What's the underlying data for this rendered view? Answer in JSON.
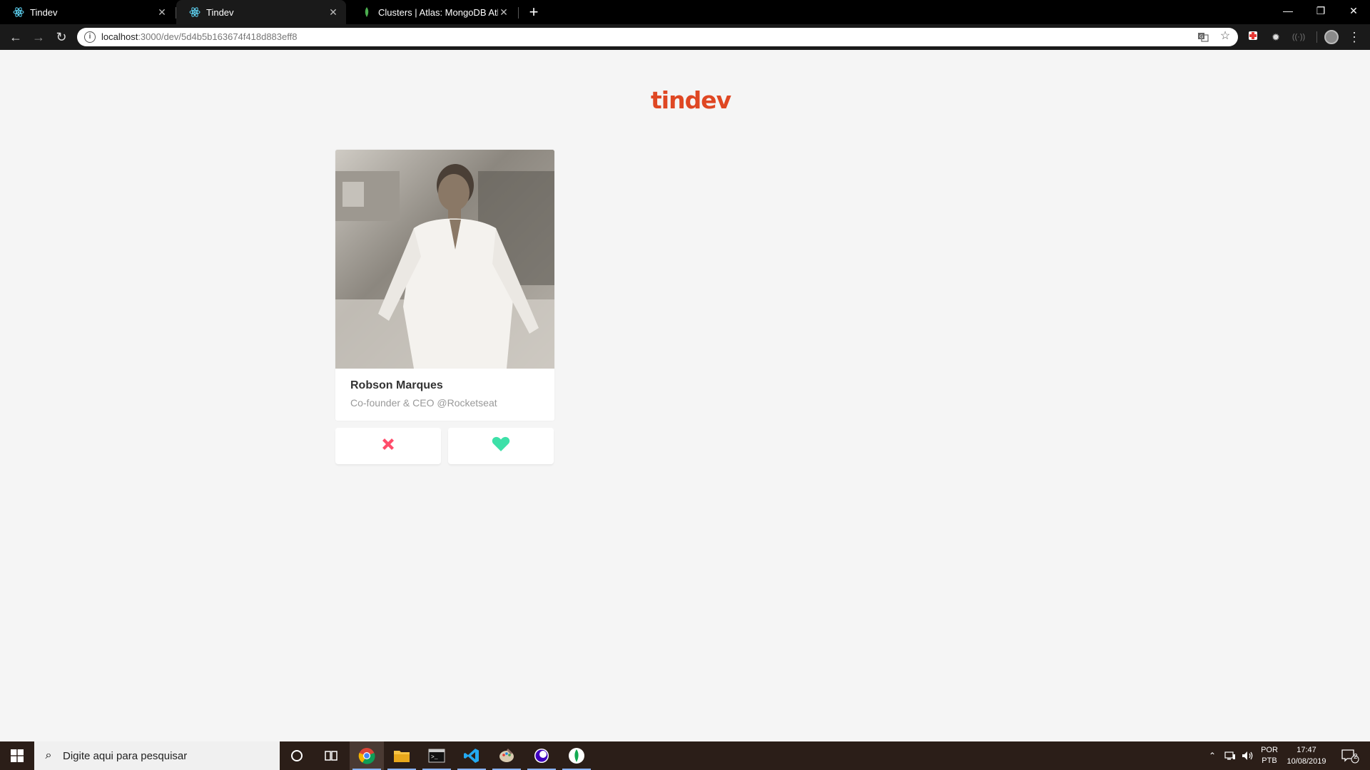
{
  "browser": {
    "tabs": [
      {
        "title": "Tindev",
        "active": false
      },
      {
        "title": "Tindev",
        "active": true
      },
      {
        "title": "Clusters | Atlas: MongoDB Atlas",
        "active": false
      }
    ],
    "url_host": "localhost",
    "url_path": ":3000/dev/5d4b5b163674f418d883eff8"
  },
  "app": {
    "logo_text": "tindev",
    "brand_color": "#df4723",
    "dislike_color": "#ff4c6a",
    "like_color": "#3de0a8"
  },
  "dev_card": {
    "name": "Robson Marques",
    "bio": "Co-founder & CEO @Rocketseat"
  },
  "taskbar": {
    "search_placeholder": "Digite aqui para pesquisar",
    "lang_primary": "POR",
    "lang_secondary": "PTB",
    "time": "17:47",
    "date": "10/08/2019",
    "notification_count": "2"
  }
}
